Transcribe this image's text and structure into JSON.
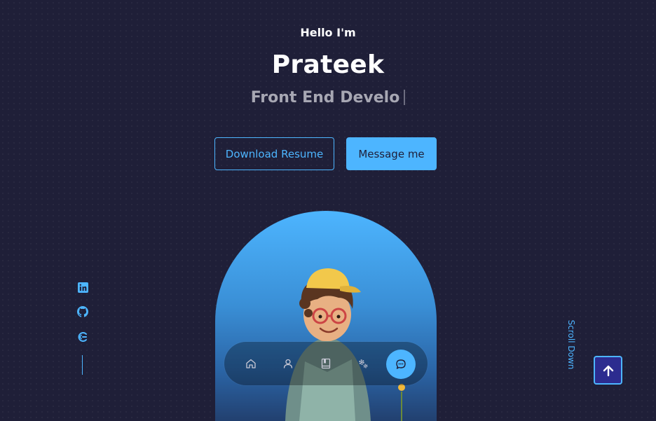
{
  "header": {
    "greeting": "Hello I'm",
    "name": "Prateek",
    "role_typed": "Front End Develo"
  },
  "cta": {
    "download_label": "Download Resume",
    "message_label": "Message me"
  },
  "socials": [
    {
      "icon": "linkedin-icon"
    },
    {
      "icon": "github-icon"
    },
    {
      "icon": "google-developers-icon"
    }
  ],
  "scroll_label": "Scroll Down",
  "nav": {
    "items": [
      "home-icon",
      "user-icon",
      "book-icon",
      "services-gear-icon",
      "chat-icon"
    ],
    "active": "chat-icon"
  },
  "colors": {
    "background": "#1f1f38",
    "accent": "#4db5ff",
    "to_top_bg": "#2c2c8f"
  }
}
